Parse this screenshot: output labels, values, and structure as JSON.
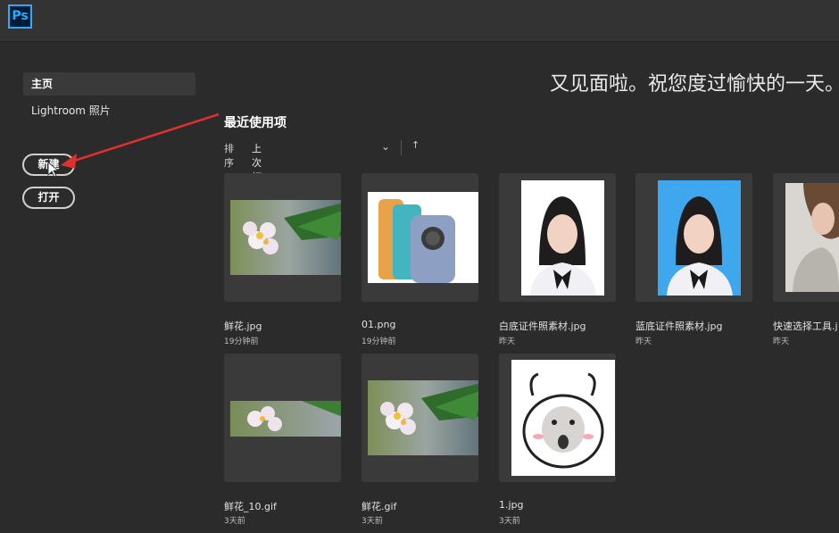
{
  "app": {
    "logo_text": "Ps",
    "accent": "#31a8ff"
  },
  "sidebar": {
    "items": [
      {
        "label": "主页",
        "active": true
      },
      {
        "label": "Lightroom 照片",
        "active": false
      }
    ],
    "new_button": "新建",
    "open_button": "打开"
  },
  "greeting": "又见面啦。祝您度过愉快的一天。",
  "recent": {
    "title": "最近使用项",
    "sort_label": "排序",
    "sort_value": "上次打开时间",
    "sort_chevron": "⌄",
    "sort_direction": "↑"
  },
  "files": [
    {
      "name": "鲜花.jpg",
      "time": "19分钟前",
      "thumb": "flower-wide"
    },
    {
      "name": "01.png",
      "time": "19分钟前",
      "thumb": "phone"
    },
    {
      "name": "白底证件照素材.jpg",
      "time": "昨天",
      "thumb": "portrait-white"
    },
    {
      "name": "蓝底证件照素材.jpg",
      "time": "昨天",
      "thumb": "portrait-blue"
    },
    {
      "name": "快速选择工具.j",
      "time": "昨天",
      "thumb": "woman"
    },
    {
      "name": "鲜花_10.gif",
      "time": "3天前",
      "thumb": "flower-strip"
    },
    {
      "name": "鲜花.gif",
      "time": "3天前",
      "thumb": "flower-wide"
    },
    {
      "name": "1.jpg",
      "time": "3天前",
      "thumb": "meme"
    }
  ]
}
